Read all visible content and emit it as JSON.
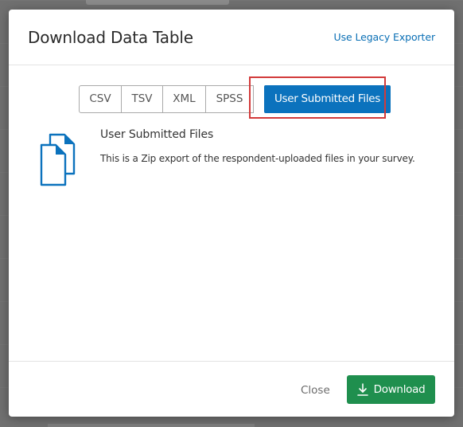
{
  "dialog": {
    "title": "Download Data Table",
    "legacy_link": "Use Legacy Exporter"
  },
  "tabs": {
    "items": [
      {
        "label": "CSV"
      },
      {
        "label": "TSV"
      },
      {
        "label": "XML"
      },
      {
        "label": "SPSS"
      }
    ],
    "active": {
      "label": "User Submitted Files"
    }
  },
  "content": {
    "icon": "documents-icon",
    "title": "User Submitted Files",
    "description": "This is a Zip export of the respondent-uploaded files in your survey."
  },
  "footer": {
    "close_label": "Close",
    "download_label": "Download",
    "download_icon": "download-arrow-icon"
  },
  "colors": {
    "accent_blue": "#0b72bd",
    "link_blue": "#0a6fb5",
    "download_green": "#1f8f4e",
    "highlight_red": "#d23a3a"
  }
}
